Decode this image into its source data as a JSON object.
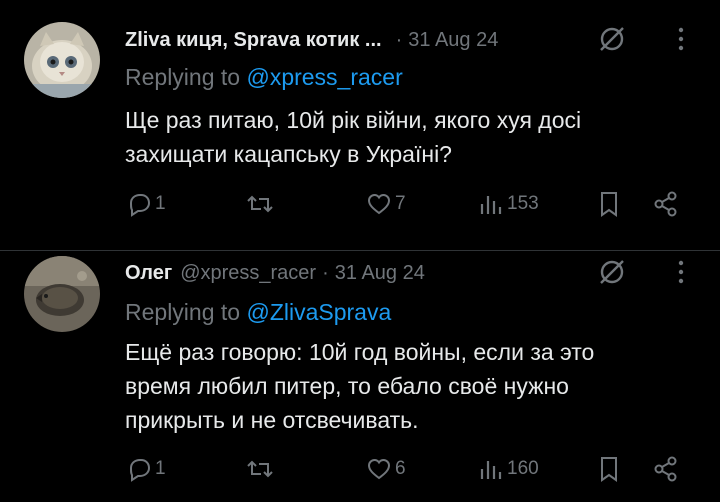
{
  "colors": {
    "background": "#000000",
    "text": "#e7e9ea",
    "muted": "#71767b",
    "link": "#1d9bf0",
    "divider": "#2f3336"
  },
  "tweets": [
    {
      "author_name": "Zliva киця, Sprava котик ...",
      "handle": "",
      "separator": "·",
      "date": "31 Aug 24",
      "replying_prefix": "Replying to ",
      "replying_to": "@xpress_racer",
      "text_lines": [
        "Ще раз питаю, 10й рік війни, якого хуя досі",
        "захищати кацапську в Україні?"
      ],
      "replies": "1",
      "reposts": "",
      "likes": "7",
      "views": "153",
      "avatar_icon": "cat-avatar"
    },
    {
      "author_name": "Олег",
      "handle": "@xpress_racer",
      "separator": "·",
      "date": "31 Aug 24",
      "replying_prefix": "Replying to ",
      "replying_to": "@ZlivaSprava",
      "text_lines": [
        "Ещё раз говорю: 10й год войны, если за это",
        "время любил питер, то ебало своё нужно",
        "прикрыть и не отсвечивать."
      ],
      "replies": "1",
      "reposts": "",
      "likes": "6",
      "views": "160",
      "avatar_icon": "hedgehog-avatar"
    }
  ],
  "icons": [
    "grok-icon",
    "more-icon",
    "reply-icon",
    "repost-icon",
    "like-icon",
    "views-icon",
    "bookmark-icon",
    "share-icon"
  ]
}
